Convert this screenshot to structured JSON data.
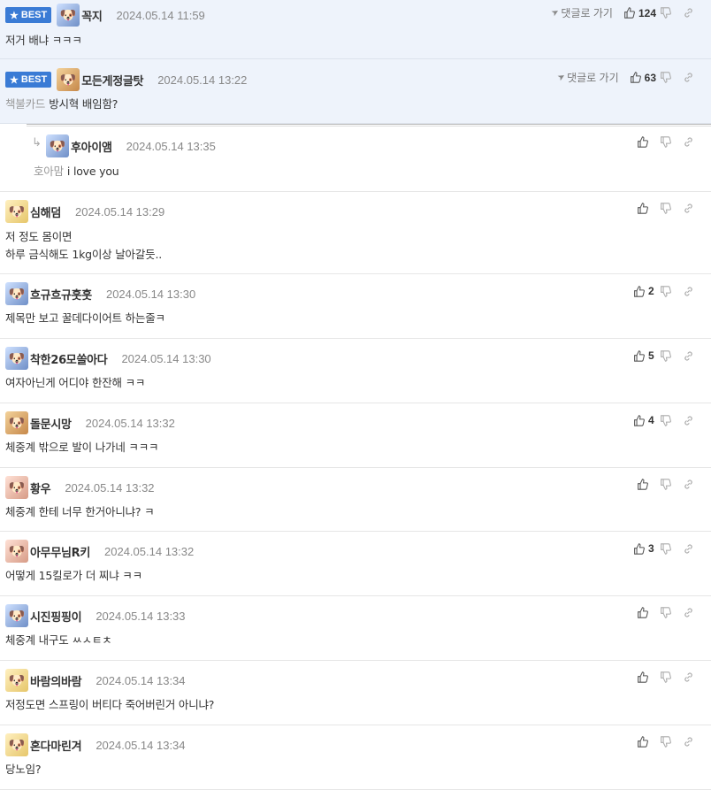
{
  "goto_label": "댓글로 가기",
  "best_label": "BEST",
  "comments": [
    {
      "nick": "꼭지",
      "date": "2024.05.14 11:59",
      "text": "저거 배냐 ㅋㅋㅋ",
      "tag": "",
      "likes": "124",
      "avatar": "dog-blue-avatar"
    },
    {
      "nick": "모든게정글탓",
      "date": "2024.05.14 13:22",
      "text": "방시혁 배임함?",
      "tag": "책불카드",
      "likes": "63",
      "avatar": "dog-brown-avatar"
    },
    {
      "nick": "후아이앰",
      "date": "2024.05.14 13:35",
      "text": "i love you",
      "tag": "호아맘",
      "likes": "",
      "avatar": "dog-blue-avatar"
    },
    {
      "nick": "심해덤",
      "date": "2024.05.14 13:29",
      "text1": "저 정도 몸이면",
      "text2": "하루 금식해도 1kg이상 날아갈듯..",
      "likes": "",
      "avatar": "dog-yellow-avatar"
    },
    {
      "nick": "흐규흐규훗훗",
      "date": "2024.05.14 13:30",
      "text": "제목만 보고 꿀데다이어트 하는줄ㅋ",
      "likes": "2",
      "avatar": "dog-blue-avatar"
    },
    {
      "nick": "착한26모쏠아다",
      "date": "2024.05.14 13:30",
      "text": "여자아닌게 어디야 한잔해 ㅋㅋ",
      "likes": "5",
      "avatar": "dog-blue-avatar"
    },
    {
      "nick": "돌문시망",
      "date": "2024.05.14 13:32",
      "text": "체중계 밖으로 발이 나가네 ㅋㅋㅋ",
      "likes": "4",
      "avatar": "dog-brown-avatar"
    },
    {
      "nick": "황우",
      "date": "2024.05.14 13:32",
      "text": "체중계 한테 너무 한거아니냐? ㅋ",
      "likes": "",
      "avatar": "dog-pink-avatar"
    },
    {
      "nick": "아무무님R키",
      "date": "2024.05.14 13:32",
      "text": "어떻게 15킬로가 더 찌냐 ㅋㅋ",
      "likes": "3",
      "avatar": "dog-pink-avatar"
    },
    {
      "nick": "시진핑핑이",
      "date": "2024.05.14 13:33",
      "text": "체중계 내구도 ㅆㅅㅌㅊ",
      "likes": "",
      "avatar": "dog-blue-avatar"
    },
    {
      "nick": "바람의바람",
      "date": "2024.05.14 13:34",
      "text": "저정도면 스프링이 버티다 죽어버린거 아니냐?",
      "likes": "",
      "avatar": "dog-yellow-avatar"
    },
    {
      "nick": "혼다마린겨",
      "date": "2024.05.14 13:34",
      "text": "당노임?",
      "likes": "",
      "avatar": "dog-yellow-avatar"
    }
  ]
}
